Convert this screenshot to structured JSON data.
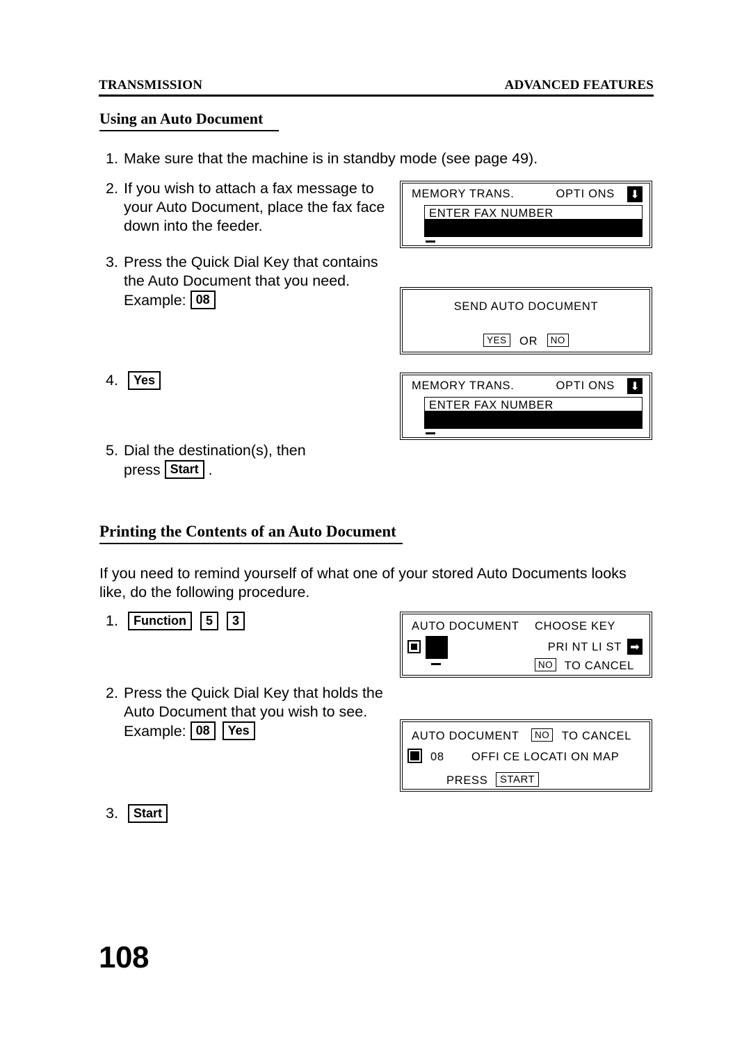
{
  "header": {
    "left": "TRANSMISSION",
    "right": "ADVANCED FEATURES"
  },
  "page_number": "108",
  "section1": {
    "heading": "Using an Auto Document",
    "steps": [
      {
        "num": "1.",
        "lines": [
          "Make sure that the machine is in standby mode (see page   49)."
        ]
      },
      {
        "num": "2.",
        "lines": [
          "If you wish to attach a fax message to",
          "your Auto Document, place the fax face",
          "down into the feeder."
        ]
      },
      {
        "num": "3.",
        "lines": [
          "Press the Quick Dial Key that contains",
          "the Auto Document that you need."
        ],
        "example_label": "Example:",
        "example_keys": [
          "08"
        ]
      },
      {
        "num": "4.",
        "keys": [
          "Yes"
        ]
      },
      {
        "num": "5.",
        "lines": [
          "Dial the destination(s), then"
        ],
        "press_label": "press",
        "press_key": "Start",
        "press_period": "."
      }
    ]
  },
  "section2": {
    "heading": "Printing the Contents of an Auto Document",
    "intro": [
      "If you need to remind yourself of what one of your stored Auto Documents looks",
      "like, do the following procedure."
    ],
    "steps": [
      {
        "num": "1.",
        "keys": [
          "Function",
          "5",
          "3"
        ]
      },
      {
        "num": "2.",
        "lines": [
          "Press the Quick Dial Key that holds the",
          "Auto Document that you wish to see."
        ],
        "example_label": "Example:",
        "example_keys": [
          "08",
          "Yes"
        ]
      },
      {
        "num": "3.",
        "keys": [
          "Start"
        ]
      }
    ]
  },
  "lcd_panels": [
    {
      "id": "memory-trans-1",
      "title": "MEMORY TRANS.",
      "options_label": "OPTI ONS",
      "arrow_icon": "down-arrow-icon",
      "arrow_glyph": "⬇",
      "field_label": "ENTER FAX NUMBER"
    },
    {
      "id": "send-auto-document",
      "title": "SEND AUTO DOCUMENT",
      "yes_label": "YES",
      "or_label": "OR",
      "no_label": "NO"
    },
    {
      "id": "memory-trans-2",
      "title": "MEMORY TRANS.",
      "options_label": "OPTI ONS",
      "arrow_icon": "down-arrow-icon",
      "arrow_glyph": "⬇",
      "field_label": "ENTER FAX NUMBER"
    },
    {
      "id": "auto-document-choose-key",
      "title": "AUTO DOCUMENT",
      "choose_key_label": "CHOOSE KEY",
      "print_list_label": "PRI NT LI ST",
      "arrow_icon": "right-arrow-icon",
      "arrow_glyph": "➡",
      "no_label": "NO",
      "to_cancel_label": "TO CANCEL"
    },
    {
      "id": "auto-document-office-map",
      "title": "AUTO DOCUMENT",
      "no_label": "NO",
      "to_cancel_label": "TO CANCEL",
      "key_number": "08",
      "document_name": "OFFI CE LOCATI ON MAP",
      "press_label": "PRESS",
      "start_label": "START"
    }
  ],
  "colors": {
    "ink": "#000000",
    "paper": "#ffffff"
  }
}
